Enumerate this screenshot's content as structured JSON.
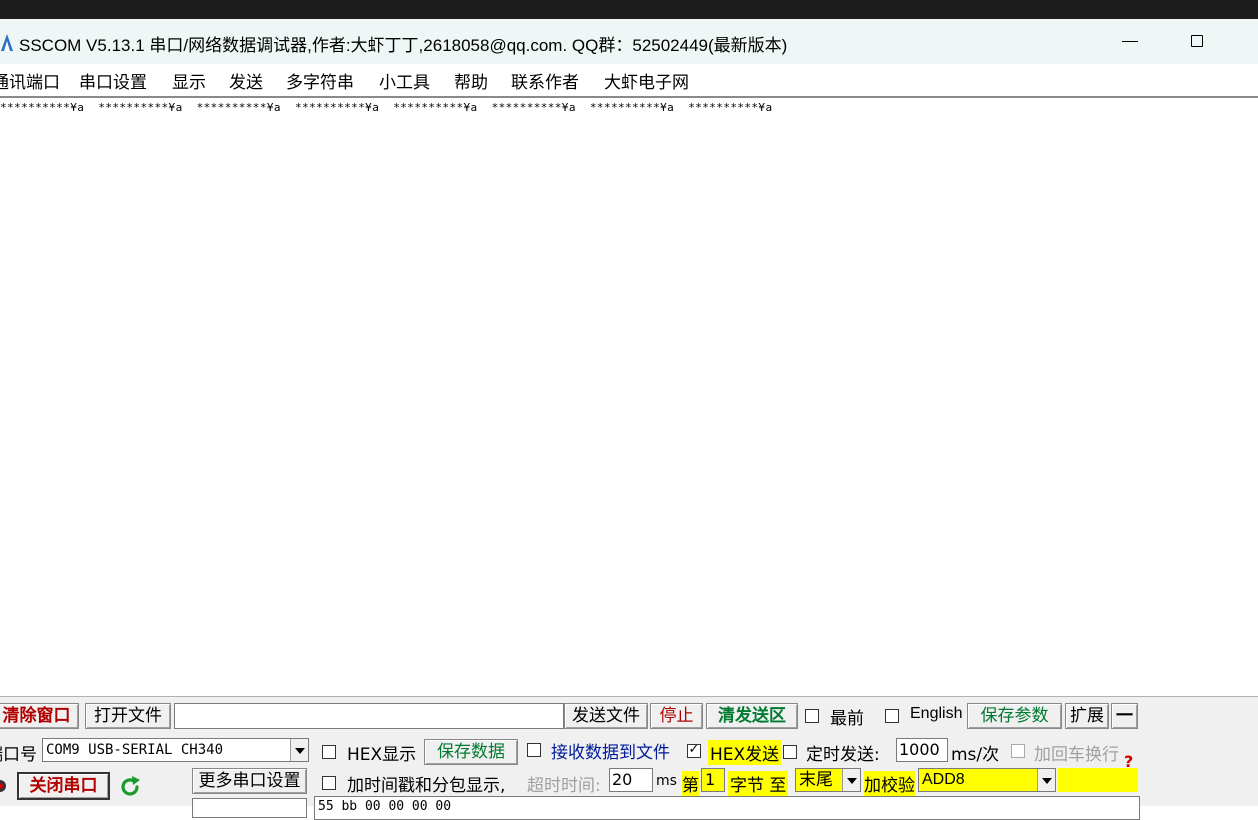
{
  "window": {
    "title": "SSCOM V5.13.1 串口/网络数据调试器,作者:大虾丁丁,2618058@qq.com. QQ群：52502449(最新版本)"
  },
  "menu": {
    "items": [
      "通讯端口",
      "串口设置",
      "显示",
      "发送",
      "多字符串",
      "小工具",
      "帮助",
      "联系作者",
      "大虾电子网"
    ]
  },
  "receive": {
    "text": "**********¥a  **********¥a  **********¥a  **********¥a  **********¥a  **********¥a  **********¥a  **********¥a"
  },
  "toolbar": {
    "clear_window": "清除窗口",
    "open_file": "打开文件",
    "file_path": "",
    "send_file": "发送文件",
    "stop": "停止",
    "clear_send": "清发送区",
    "topmost_label": "最前",
    "english_label": "English",
    "save_params": "保存参数",
    "expand": "扩展",
    "collapse": "一"
  },
  "port": {
    "label": "端口号",
    "selected": "COM9 USB-SERIAL CH340",
    "close_button": "关闭串口",
    "more_settings": "更多串口设置"
  },
  "receive_options": {
    "hex_display": "HEX显示",
    "save_data": "保存数据",
    "receive_to_file": "接收数据到文件",
    "timestamp": "加时间戳和分包显示,",
    "timeout_label": "超时时间:",
    "timeout_value": "20",
    "timeout_unit": "ms"
  },
  "send_options": {
    "hex_send": "HEX发送",
    "timed_send": "定时发送:",
    "interval": "1000",
    "interval_unit": "ms/次",
    "add_crlf": "加回车换行",
    "byte_from_prefix": "第",
    "byte_from": "1",
    "byte_to_label": "字节 至",
    "byte_to": "末尾",
    "checksum_label": "加校验",
    "checksum": "ADD8",
    "help_mark": "?"
  },
  "send_box": {
    "text": "55 bb 00 00 00 00"
  },
  "colors": {
    "title_bg": "#eef7f6",
    "highlight": "#ffff00",
    "danger": "#b00000",
    "success": "#007a30"
  }
}
